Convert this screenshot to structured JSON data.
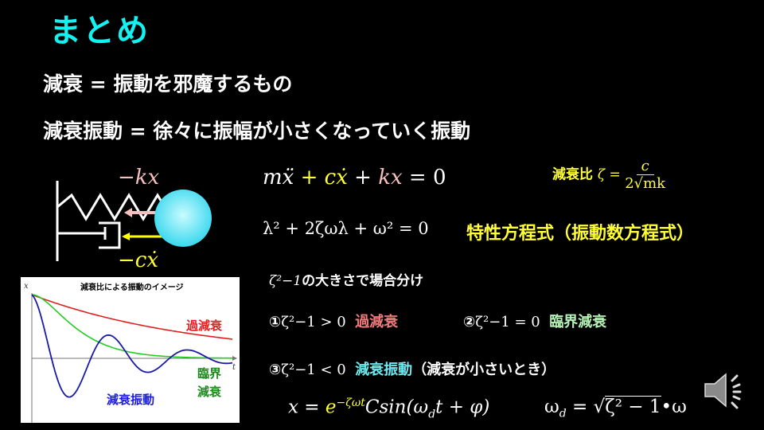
{
  "slide": {
    "title": "まとめ",
    "definition_1": "減衰 = 振動を邪魔するもの",
    "definition_2": "減衰振動 = 徐々に振幅が小さくなっていく振動"
  },
  "diagram": {
    "spring_force_label": "−kx",
    "damper_force_label": "−cẋ",
    "colors": {
      "mass": "#5ee8f5",
      "spring_arrow": "#f6c0c0",
      "damper_arrow": "#ffff00"
    }
  },
  "equations": {
    "motion": {
      "m_term": "mẍ",
      "plus1": " + ",
      "c_term": "cẋ",
      "plus2": " + ",
      "k_term": "kx",
      "rhs": " = 0"
    },
    "damping_ratio": {
      "label": "減衰比",
      "symbol": "ζ = ",
      "numerator": "c",
      "denominator": "2√mk"
    },
    "characteristic": {
      "expr": "λ² + 2ζωλ + ω² = 0",
      "label": "特性方程式（振動数方程式）"
    },
    "solution": {
      "x": "x = ",
      "exp": "e",
      "exp_power": "−ζωt",
      "rest": "Csin(ω",
      "sub_d": "d",
      "rest2": "t + φ)"
    },
    "omega_d": {
      "lhs": "ω",
      "sub_d": "d",
      "eq": " = √",
      "radicand": "ζ² − 1",
      "tail": "•ω"
    }
  },
  "cases": {
    "heading_math": "ζ²−1",
    "heading_text": "の大きさで場合分け",
    "items": [
      {
        "marker": "①",
        "condition": "ζ²−1 > 0",
        "name": "過減衰",
        "note": ""
      },
      {
        "marker": "②",
        "condition": "ζ²−1 = 0",
        "name": "臨界減衰",
        "note": ""
      },
      {
        "marker": "③",
        "condition": "ζ²−1 < 0",
        "name": "減衰振動",
        "note": "（減衰が小さいとき）"
      }
    ]
  },
  "graph": {
    "title": "減衰比による振動のイメージ",
    "x_axis_label": "t",
    "y_axis_label": "x",
    "labels": {
      "over": "過減衰",
      "critical_1": "臨界",
      "critical_2": "減衰",
      "under": "減衰振動"
    },
    "colors": {
      "over": "#e02020",
      "critical": "#22cc22",
      "under": "#1a1aa8",
      "over_label": "#e02020",
      "critical_label": "#1a8a1a",
      "under_label": "#1a1ae0"
    }
  },
  "controls": {
    "audio_icon": "speaker-icon"
  }
}
